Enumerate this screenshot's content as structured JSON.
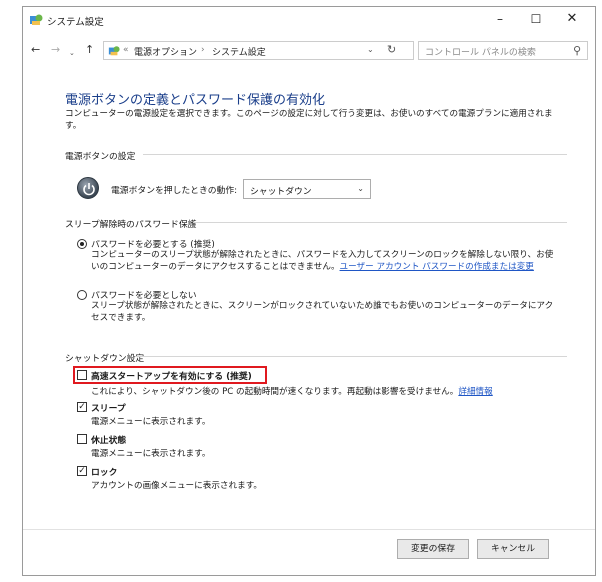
{
  "window": {
    "title": "システム設定"
  },
  "titlebar": {
    "minimize": "–",
    "maximize": "☐",
    "close": "✕"
  },
  "nav": {
    "back": "←",
    "forward": "→",
    "history": "⌄",
    "up": "↑",
    "breadcrumb_prefix": "«",
    "crumb1": "電源オプション",
    "crumb_sep": "›",
    "crumb2": "システム設定",
    "dropdown": "⌄",
    "refresh": "↻",
    "search_placeholder": "コントロール パネルの検索",
    "search_icon": "⚲"
  },
  "page": {
    "title": "電源ボタンの定義とパスワード保護の有効化",
    "description": "コンピューターの電源設定を選択できます。このページの設定に対して行う変更は、お使いのすべての電源プランに適用されます。"
  },
  "power_section": {
    "header": "電源ボタンの設定",
    "label": "電源ボタンを押したときの動作:",
    "select_value": "シャットダウン",
    "select_chevron": "⌄"
  },
  "password_section": {
    "header": "スリープ解除時のパスワード保護",
    "options": [
      {
        "label": "パスワードを必要とする (推奨)",
        "desc_before_link": "コンピューターのスリープ状態が解除されたときに、パスワードを入力してスクリーンのロックを解除しない限り、お使いのコンピューターのデータにアクセスすることはできません。",
        "link": "ユーザー アカウント パスワードの作成または変更",
        "selected": true
      },
      {
        "label": "パスワードを必要としない",
        "desc": "スリープ状態が解除されたときに、スクリーンがロックされていないため誰でもお使いのコンピューターのデータにアクセスできます。",
        "selected": false
      }
    ]
  },
  "shutdown_section": {
    "header": "シャットダウン設定",
    "items": [
      {
        "label": "高速スタートアップを有効にする (推奨)",
        "desc": "これにより、シャットダウン後の PC の起動時間が速くなります。再起動は影響を受けません。",
        "link": "詳細情報",
        "checked": false
      },
      {
        "label": "スリープ",
        "desc": "電源メニューに表示されます。",
        "checked": true
      },
      {
        "label": "休止状態",
        "desc": "電源メニューに表示されます。",
        "checked": false
      },
      {
        "label": "ロック",
        "desc": "アカウントの画像メニューに表示されます。",
        "checked": true
      }
    ]
  },
  "footer": {
    "save": "変更の保存",
    "cancel": "キャンセル"
  },
  "colors": {
    "title_blue": "#1a3e8a",
    "link_blue": "#1f56c5",
    "highlight_red": "#e0191f"
  }
}
